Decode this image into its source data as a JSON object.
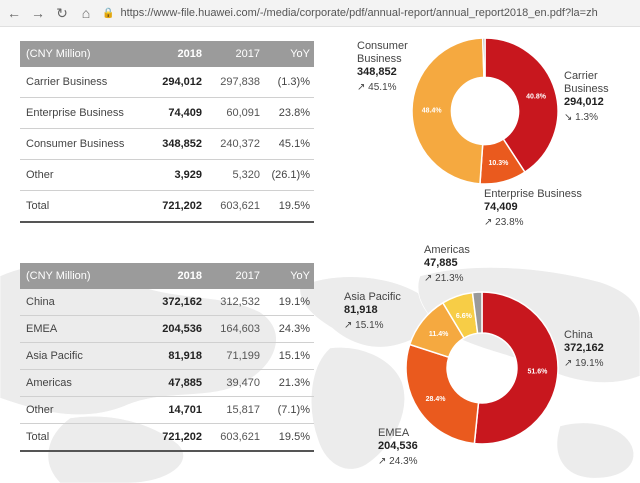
{
  "browser": {
    "back_icon": "←",
    "forward_icon": "→",
    "reload_icon": "↻",
    "home_icon": "⌂",
    "lock_icon": "🔒",
    "url": "https://www-file.huawei.com/-/media/corporate/pdf/annual-report/annual_report2018_en.pdf?la=zh"
  },
  "table_business": {
    "headers": [
      "(CNY Million)",
      "2018",
      "2017",
      "YoY"
    ],
    "rows": [
      [
        "Carrier Business",
        "294,012",
        "297,838",
        "(1.3)%"
      ],
      [
        "Enterprise Business",
        "74,409",
        "60,091",
        "23.8%"
      ],
      [
        "Consumer Business",
        "348,852",
        "240,372",
        "45.1%"
      ],
      [
        "Other",
        "3,929",
        "5,320",
        "(26.1)%"
      ],
      [
        "Total",
        "721,202",
        "603,621",
        "19.5%"
      ]
    ]
  },
  "table_region": {
    "headers": [
      "(CNY Million)",
      "2018",
      "2017",
      "YoY"
    ],
    "rows": [
      [
        "China",
        "372,162",
        "312,532",
        "19.1%"
      ],
      [
        "EMEA",
        "204,536",
        "164,603",
        "24.3%"
      ],
      [
        "Asia Pacific",
        "81,918",
        "71,199",
        "15.1%"
      ],
      [
        "Americas",
        "47,885",
        "39,470",
        "21.3%"
      ],
      [
        "Other",
        "14,701",
        "15,817",
        "(7.1)%"
      ],
      [
        "Total",
        "721,202",
        "603,621",
        "19.5%"
      ]
    ]
  },
  "chart_data": [
    {
      "type": "pie",
      "categories": [
        "Carrier Business",
        "Enterprise Business",
        "Consumer Business",
        "Other"
      ],
      "values": [
        40.8,
        10.3,
        48.4,
        0.5
      ],
      "slice_labels": [
        "40.8%",
        "10.3%",
        "48.4%",
        ""
      ],
      "callouts": [
        {
          "name": "Carrier Business",
          "value": "294,012",
          "yoy": "1.3%",
          "yoy_arrow": "↘"
        },
        {
          "name": "Enterprise Business",
          "value": "74,409",
          "yoy": "23.8%",
          "yoy_arrow": "↗"
        },
        {
          "name": "Consumer Business",
          "value": "348,852",
          "yoy": "45.1%",
          "yoy_arrow": "↗"
        }
      ],
      "colors": [
        "#c8171e",
        "#ea5a1e",
        "#f5a940",
        "#9a9a9a"
      ]
    },
    {
      "type": "pie",
      "categories": [
        "China",
        "EMEA",
        "Asia Pacific",
        "Americas",
        "Other"
      ],
      "values": [
        51.6,
        28.4,
        11.4,
        6.6,
        2.0
      ],
      "slice_labels": [
        "51.6%",
        "28.4%",
        "11.4%",
        "6.6%",
        ""
      ],
      "callouts": [
        {
          "name": "China",
          "value": "372,162",
          "yoy": "19.1%",
          "yoy_arrow": "↗"
        },
        {
          "name": "EMEA",
          "value": "204,536",
          "yoy": "24.3%",
          "yoy_arrow": "↗"
        },
        {
          "name": "Asia Pacific",
          "value": "81,918",
          "yoy": "15.1%",
          "yoy_arrow": "↗"
        },
        {
          "name": "Americas",
          "value": "47,885",
          "yoy": "21.3%",
          "yoy_arrow": "↗"
        }
      ],
      "colors": [
        "#c8171e",
        "#ea5a1e",
        "#f5a940",
        "#f7cd46",
        "#9a9a9a"
      ]
    }
  ]
}
